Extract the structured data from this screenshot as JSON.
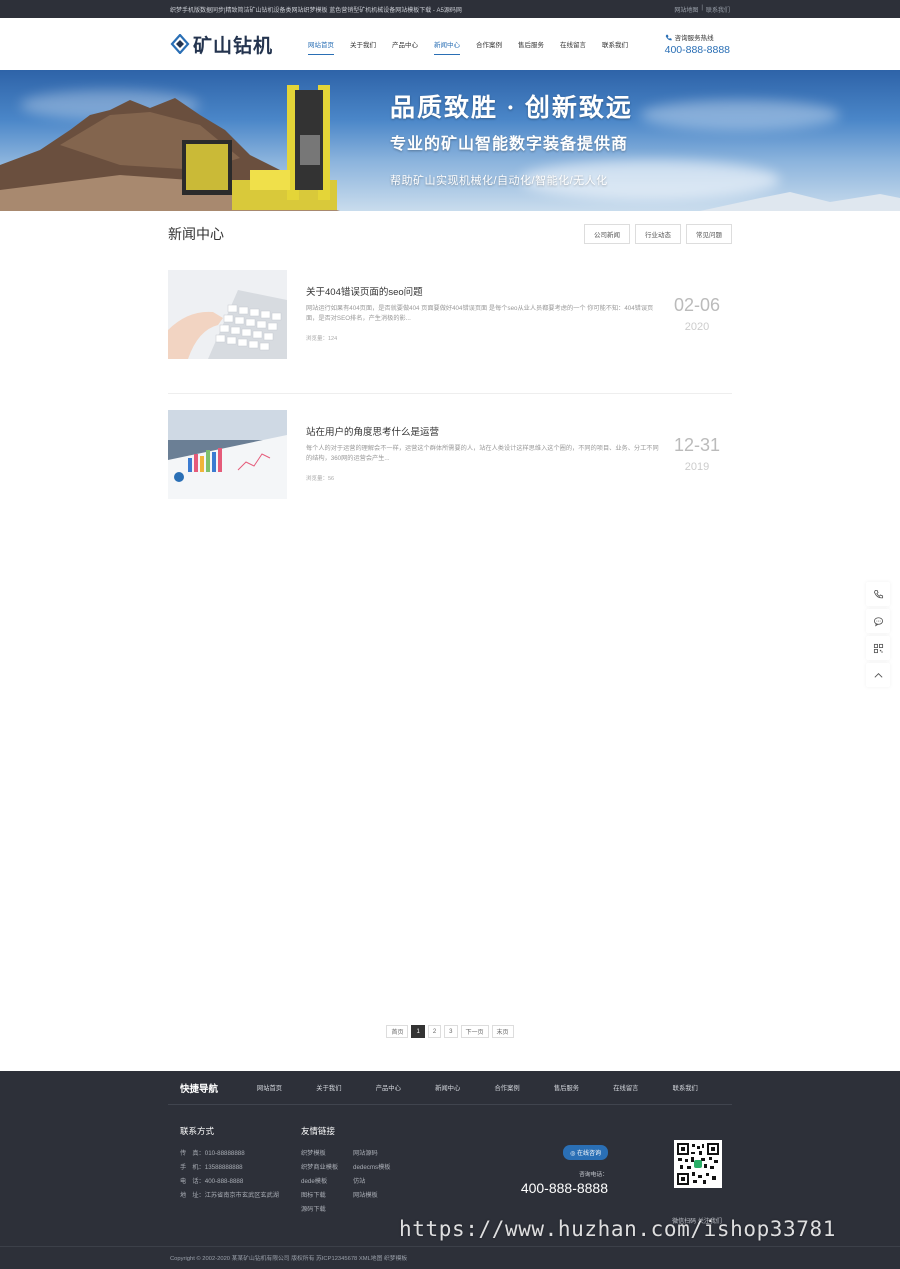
{
  "topbar": {
    "left": "织梦手机版数据同步|精致简洁矿山钻机设备类网站织梦模板 蓝色营销型矿机机械设备网站模板下载 - A5源码网",
    "links": [
      "网站地图",
      "|",
      "联系我们"
    ]
  },
  "header": {
    "logo_text": "矿山钻机",
    "nav": [
      "网站首页",
      "关于我们",
      "产品中心",
      "新闻中心",
      "合作案例",
      "售后服务",
      "在线留言",
      "联系我们"
    ],
    "hotline_label": "咨询服务热线",
    "hotline_number": "400-888-8888"
  },
  "banner": {
    "title": "品质致胜 · 创新致远",
    "subtitle": "专业的矿山智能数字装备提供商",
    "tagline": "帮助矿山实现机械化/自动化/智能化/无人化"
  },
  "section": {
    "title": "新闻中心",
    "categories": [
      "公司新闻",
      "行业动态",
      "常见问题"
    ]
  },
  "news": [
    {
      "title": "关于404错误页面的seo问题",
      "desc": "网站运行如果有404页面，是否就要做404 页面要做好404错误页面 是每个seo从业人员都要考虑的一个 你可能不知：404错误页面，是否对SEO排名，产生消极的影...",
      "views": "浏览量：124",
      "date_md": "02-06",
      "year": "2020"
    },
    {
      "title": "站在用户的角度思考什么是运营",
      "desc": "每个人的对于运营的理解会不一样，运营这个群体所需要的人，站在人类设计这样思维入这个圈的，不同的项目、业务、分工不同的结构，360网的运营会产生...",
      "views": "浏览量：56",
      "date_md": "12-31",
      "year": "2019"
    }
  ],
  "pager": [
    "首页",
    "1",
    "2",
    "3",
    "下一页",
    "末页"
  ],
  "footer": {
    "nav_title": "快捷导航",
    "nav": [
      "网站首页",
      "关于我们",
      "产品中心",
      "新闻中心",
      "合作案例",
      "售后服务",
      "在线留言",
      "联系我们"
    ],
    "contact_title": "联系方式",
    "contact": [
      "传　真：010-88888888",
      "手　机：13588888888",
      "电　话：400-888-8888",
      "地　址：江苏省南京市玄武区玄武湖"
    ],
    "friends_title": "友情链接",
    "friends": [
      "织梦模板",
      "网站源码",
      "织梦商业模板",
      "dedecms模板",
      "dede模板",
      "仿站",
      "图标下载",
      "网站模板",
      "源码下载"
    ],
    "online_btn": "在线咨询",
    "consult_label": "咨询电话：",
    "consult_number": "400-888-8888",
    "qr_caption": "微信扫码 关注我们",
    "copyright": "Copyright © 2002-2020 某某矿山钻机有限公司 版权所有  苏ICP12345678  XML地图  织梦模板"
  },
  "watermark": "https://www.huzhan.com/ishop33781",
  "colors": {
    "accent": "#2a6fb5",
    "dark": "#2d3039"
  }
}
